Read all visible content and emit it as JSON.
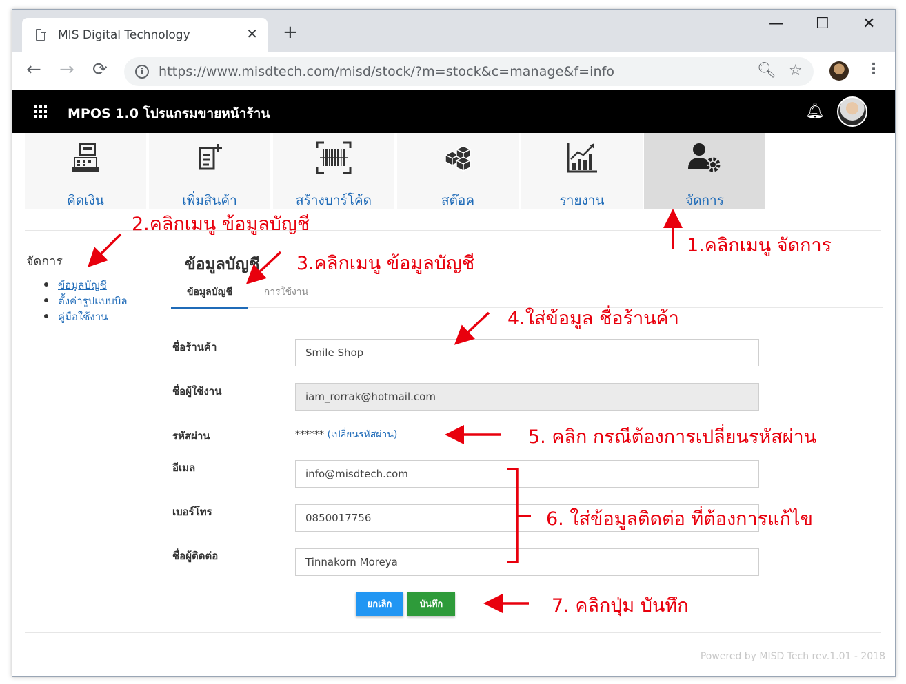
{
  "browser": {
    "tab_title": "MIS Digital Technology",
    "tab_close": "✕",
    "new_tab": "+",
    "url": "https://www.misdtech.com/misd/stock/?m=stock&c=manage&f=info",
    "window_controls": [
      "—",
      "☐",
      "✕"
    ]
  },
  "app": {
    "title": "MPOS 1.0 โปรแกรมขายหน้าร้าน"
  },
  "menu": [
    {
      "label": "คิดเงิน",
      "icon": "cash-register-icon"
    },
    {
      "label": "เพิ่มสินค้า",
      "icon": "add-product-icon"
    },
    {
      "label": "สร้างบาร์โค้ด",
      "icon": "barcode-icon"
    },
    {
      "label": "สต๊อค",
      "icon": "stock-boxes-icon"
    },
    {
      "label": "รายงาน",
      "icon": "report-chart-icon"
    },
    {
      "label": "จัดการ",
      "icon": "user-settings-icon",
      "active": true
    }
  ],
  "sidebar": {
    "heading": "จัดการ",
    "items": [
      "ข้อมูลบัญชี",
      "ตั้งค่ารูปแบบบิล",
      "คู่มือใช้งาน"
    ]
  },
  "main": {
    "title": "ข้อมูลบัญชี",
    "tabs": [
      "ข้อมูลบัญชี",
      "การใช้งาน"
    ],
    "fields": {
      "shop_name": {
        "label": "ชื่อร้านค้า",
        "value": "Smile Shop"
      },
      "username": {
        "label": "ชื่อผู้ใช้งาน",
        "value": "iam_rorrak@hotmail.com"
      },
      "password": {
        "label": "รหัสผ่าน",
        "mask": "******",
        "change_link": "(เปลี่ยนรหัสผ่าน)"
      },
      "email": {
        "label": "อีเมล",
        "value": "info@misdtech.com"
      },
      "phone": {
        "label": "เบอร์โทร",
        "value": "0850017756"
      },
      "contact": {
        "label": "ชื่อผู้ติดต่อ",
        "value": "Tinnakorn Moreya"
      }
    },
    "buttons": {
      "cancel": "ยกเลิก",
      "save": "บันทึก"
    }
  },
  "footer": "Powered by MISD Tech rev.1.01 - 2018",
  "annotations": {
    "a1": "1.คลิกเมนู จัดการ",
    "a2": "2.คลิกเมนู ข้อมูลบัญชี",
    "a3": "3.คลิกเมนู ข้อมูลบัญชี",
    "a4": "4.ใส่ข้อมูล ชื่อร้านค้า",
    "a5": "5. คลิก กรณีต้องการเปลี่ยนรหัสผ่าน",
    "a6": "6. ใส่ข้อมูลติดต่อ ที่ต้องการแก้ไข",
    "a7": "7. คลิกปุ่ม บันทึก",
    "color": "#e8000d"
  }
}
